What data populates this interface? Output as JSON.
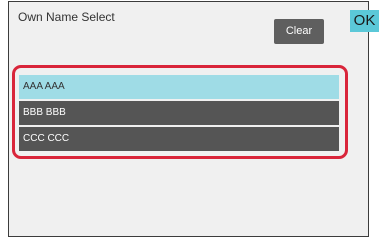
{
  "window": {
    "title": "Own Name Select"
  },
  "toolbar": {
    "clear_label": "Clear",
    "ok_label": "OK"
  },
  "name_list": {
    "items": [
      {
        "label": "AAA AAA",
        "selected": true
      },
      {
        "label": "BBB BBB",
        "selected": false
      },
      {
        "label": "CCC CCC",
        "selected": false
      }
    ]
  },
  "colors": {
    "selected_row": "#9fdce6",
    "row": "#555555",
    "ok_button": "#5bc8d8",
    "highlight_border": "#d9253a"
  }
}
